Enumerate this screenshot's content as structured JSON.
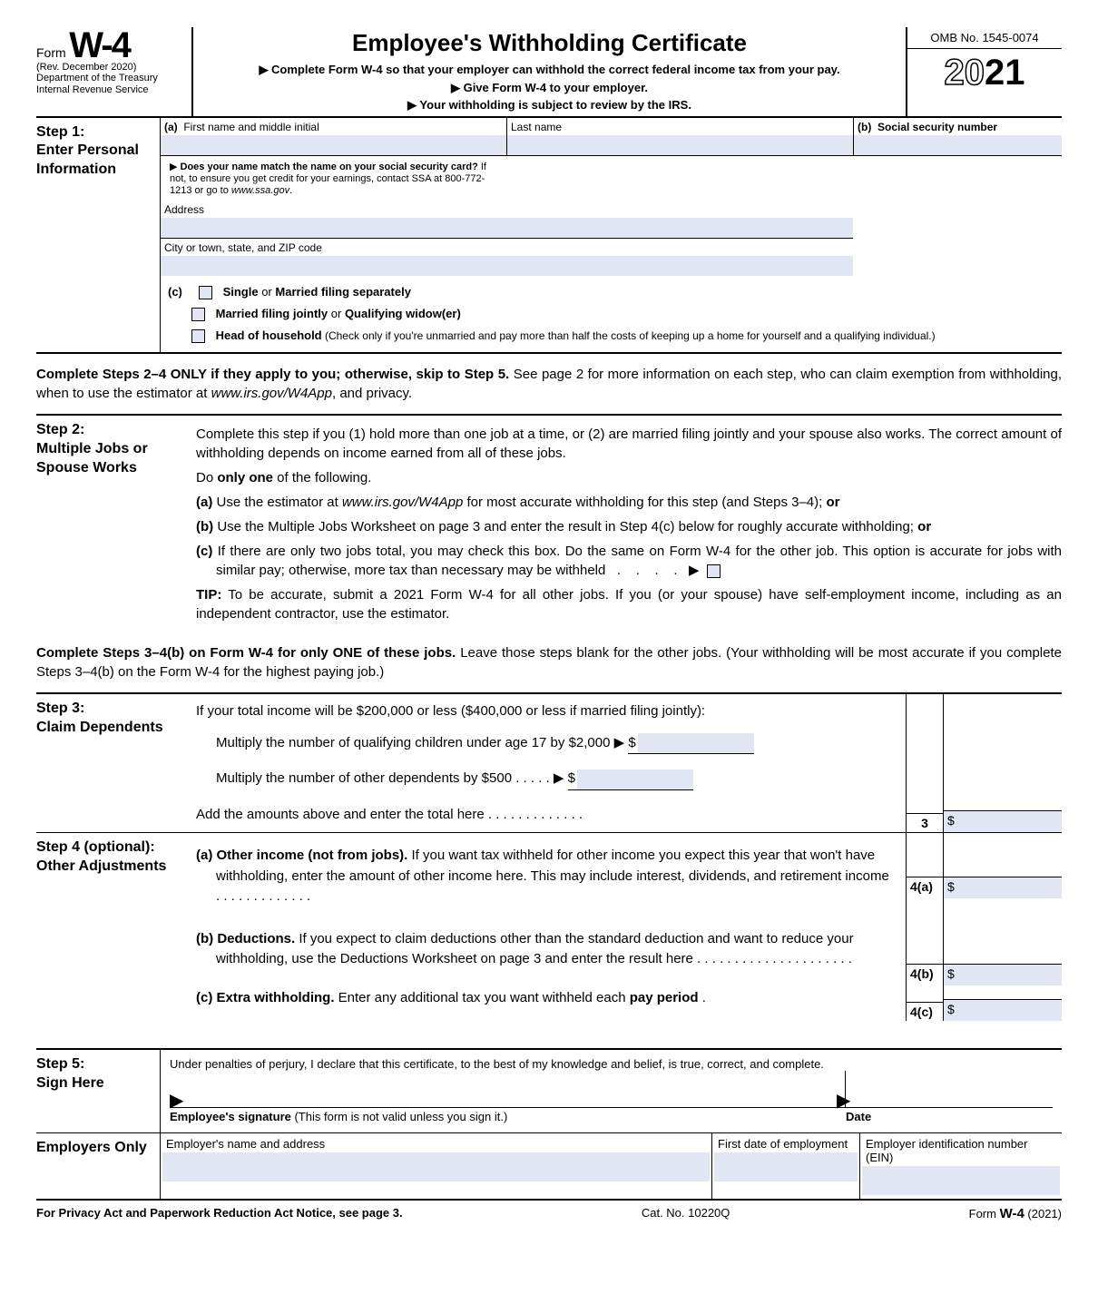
{
  "header": {
    "form_word": "Form",
    "form_code": "W-4",
    "revision": "(Rev. December 2020)",
    "dept1": "Department of the Treasury",
    "dept2": "Internal Revenue Service",
    "title": "Employee's Withholding Certificate",
    "sub1": "▶ Complete Form W-4 so that your employer can withhold the correct federal income tax from your pay.",
    "sub2": "▶ Give Form W-4 to your employer.",
    "sub3": "▶ Your withholding is subject to review by the IRS.",
    "omb": "OMB No. 1545-0074",
    "year_a": "20",
    "year_b": "21"
  },
  "step1": {
    "label": "Step 1:",
    "sub": "Enter Personal Information",
    "a_label": "(a)",
    "first": "First name and middle initial",
    "last": "Last name",
    "b_label": "(b)",
    "ssn": "Social security number",
    "address": "Address",
    "city": "City or town, state, and ZIP code",
    "ssn_note": "▶ Does your name match the name on your social security card? If not, to ensure you get credit for your earnings, contact SSA at 800-772-1213 or go to www.ssa.gov.",
    "c_label": "(c)",
    "opt1a": "Single",
    "opt1b": " or ",
    "opt1c": "Married filing separately",
    "opt2a": "Married filing jointly",
    "opt2b": " or ",
    "opt2c": "Qualifying widow(er)",
    "opt3a": "Head of household",
    "opt3b": " (Check only if you're unmarried and pay more than half the costs of keeping up a home for yourself and a qualifying individual.)"
  },
  "instr24": "Complete Steps 2–4 ONLY if they apply to you; otherwise, skip to Step 5. See page 2 for more information on each step, who can claim exemption from withholding, when to use the estimator at www.irs.gov/W4App, and privacy.",
  "instr24_bold": "Complete Steps 2–4 ONLY if they apply to you; otherwise, skip to Step 5.",
  "step2": {
    "label": "Step 2:",
    "sub": "Multiple Jobs or Spouse Works",
    "p1": "Complete this step if you (1) hold more than one job at a time, or (2) are married filing jointly and your spouse also works. The correct amount of withholding depends on income earned from all of these jobs.",
    "p2a": "Do ",
    "p2b": "only one",
    "p2c": " of the following.",
    "a": "(a) Use the estimator at www.irs.gov/W4App for most accurate withholding for this step (and Steps 3–4); or",
    "b": "(b) Use the Multiple Jobs Worksheet on page 3 and enter the result in Step 4(c) below for roughly accurate withholding; or",
    "c": "(c) If there are only two jobs total, you may check this box. Do the same on Form W-4 for the other job. This option is accurate for jobs with similar pay; otherwise, more tax than necessary may be withheld   .    .    .    .   ▶",
    "tip_label": "TIP:",
    "tip": " To be accurate, submit a 2021 Form W-4 for all other jobs. If you (or your spouse) have self-employment income, including as an independent contractor, use the estimator."
  },
  "instr34_bold": "Complete Steps 3–4(b) on Form W-4 for only ONE of these jobs.",
  "instr34": " Leave those steps blank for the other jobs. (Your withholding will be most accurate if you complete Steps 3–4(b) on the Form W-4 for the highest paying job.)",
  "step3": {
    "label": "Step 3:",
    "sub": "Claim Dependents",
    "p1": "If your total income will be $200,000 or less ($400,000 or less if married filing jointly):",
    "p2": "Multiply the number of qualifying children under age 17 by $2,000 ▶",
    "p3": "Multiply the number of other dependents by $500    .    .    .    .    . ▶",
    "p4": "Add the amounts above and enter the total here    .    .    .    .    .    .    .    .    .    .    .    .    .",
    "num": "3"
  },
  "step4": {
    "label": "Step 4 (optional):",
    "sub": "Other Adjustments",
    "a_bold": "(a) Other income (not from jobs).",
    "a": " If you want tax withheld for other income you expect this year that won't have withholding, enter the amount of other income here. This may include interest, dividends, and retirement income   .    .    .    .    .    .    .    .    .    .    .    .    .",
    "a_num": "4(a)",
    "b_bold": "(b) Deductions.",
    "b": " If you expect to claim deductions other than the standard deduction and want to reduce your withholding, use the Deductions Worksheet on page 3 and enter the result here    .    .    .    .    .    .    .    .    .    .    .    .    .    .    .    .    .    .    .    .    .",
    "b_num": "4(b)",
    "c_bold": "(c) Extra withholding.",
    "c": " Enter any additional tax you want withheld each ",
    "c_bold2": "pay period",
    "c_dots": "    .",
    "c_num": "4(c)"
  },
  "step5": {
    "label": "Step 5:",
    "sub": "Sign Here",
    "decl": "Under penalties of perjury, I declare that this certificate, to the best of my knowledge and belief, is true, correct, and complete.",
    "sig_bold": "Employee's signature",
    "sig": " (This form is not valid unless you sign it.)",
    "date": "Date"
  },
  "emp": {
    "label": "Employers Only",
    "c1": "Employer's name and address",
    "c2": "First date of employment",
    "c3": "Employer identification number (EIN)"
  },
  "footer": {
    "left": "For Privacy Act and Paperwork Reduction Act Notice, see page 3.",
    "mid": "Cat. No. 10220Q",
    "right_a": "Form ",
    "right_b": "W-4",
    "right_c": " (2021)"
  }
}
